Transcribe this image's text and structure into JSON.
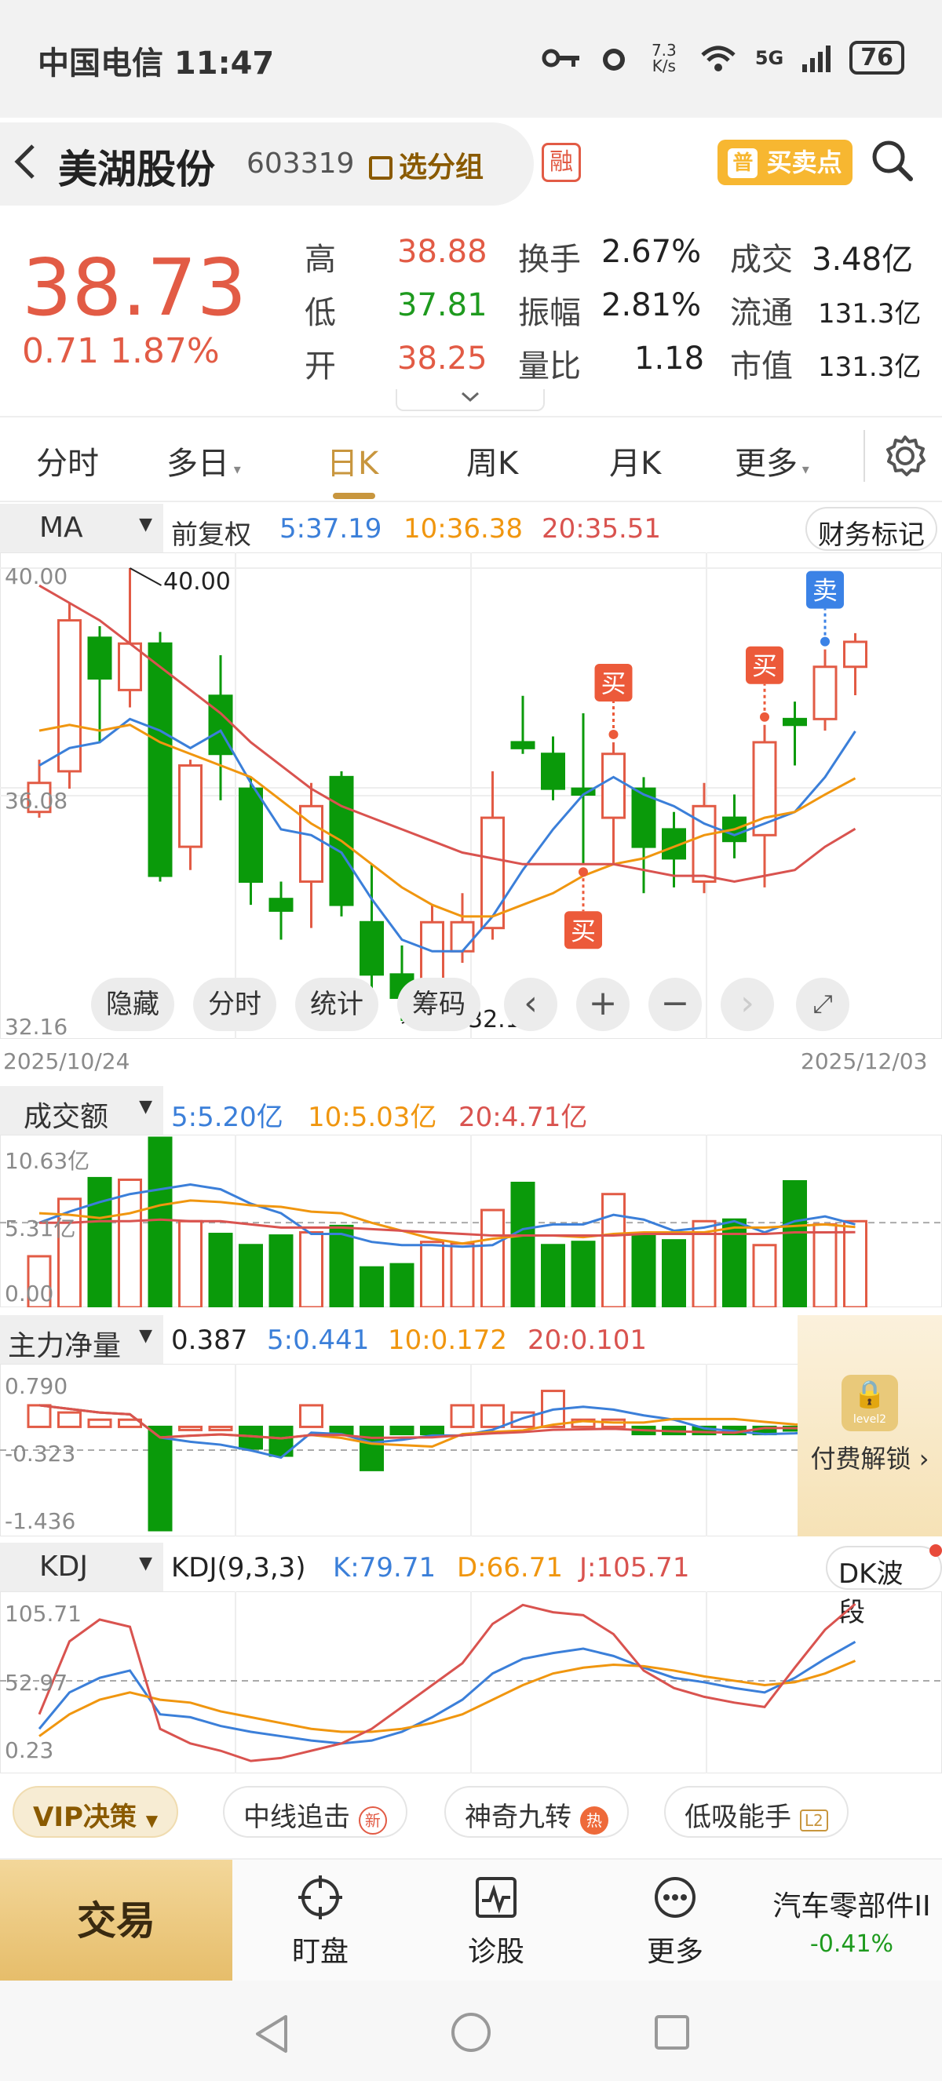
{
  "status": {
    "carrier": "中国电信 11:47",
    "net_speed": "7.3 K/s",
    "net_type": "5G",
    "battery": "76"
  },
  "header": {
    "back_icon": "chevron-left-icon",
    "stock_name": "美湖股份",
    "stock_code": "603319",
    "group_label": "选分组",
    "margin_badge": "融",
    "buy_sell_label": "买卖点",
    "buy_sell_prefix": "普"
  },
  "quote": {
    "price": "38.73",
    "change": "0.71  1.87%",
    "high_label": "高",
    "high": "38.88",
    "low_label": "低",
    "low": "37.81",
    "open_label": "开",
    "open": "38.25",
    "turnover_label": "换手",
    "turnover": "2.67%",
    "amplitude_label": "振幅",
    "amplitude": "2.81%",
    "vol_ratio_label": "量比",
    "vol_ratio": "1.18",
    "deal_label": "成交",
    "deal": "3.48亿",
    "float_label": "流通",
    "float": "131.3亿",
    "mcap_label": "市值",
    "mcap": "131.3亿"
  },
  "tabs": [
    "分时",
    "多日",
    "日K",
    "周K",
    "月K",
    "更多"
  ],
  "active_tab": 2,
  "ma_bar": {
    "label": "MA",
    "adjust": "前复权",
    "ma5": "5:37.19",
    "ma10": "10:36.38",
    "ma20": "20:35.51",
    "fin_btn": "财务标记"
  },
  "kchart": {
    "ylabels": {
      "top": "40.00",
      "mid": "36.08",
      "bottom": "32.16"
    },
    "hi_mark": "40.00",
    "lo_mark": "32.16",
    "date_start": "2025/10/24",
    "date_end": "2025/12/03",
    "buy": "买",
    "sell": "卖"
  },
  "controls": {
    "hide": "隐藏",
    "time": "分时",
    "stats": "统计",
    "chips": "筹码"
  },
  "vol_bar": {
    "label": "成交额",
    "ma5": "5:5.20亿",
    "ma10": "10:5.03亿",
    "ma20": "20:4.71亿"
  },
  "vol_axis": {
    "top": "10.63亿",
    "mid": "5.31亿",
    "bottom": "0.00"
  },
  "flow_bar": {
    "label": "主力净量",
    "value": "0.387",
    "ma5": "5:0.441",
    "ma10": "10:0.172",
    "ma20": "20:0.101"
  },
  "flow_axis": {
    "top": "0.790",
    "mid": "-0.323",
    "bottom": "-1.436"
  },
  "unlock": {
    "label": "付费解锁",
    "badge": "level2"
  },
  "kdj_bar": {
    "label": "KDJ",
    "param": "KDJ(9,3,3)",
    "k": "K:79.71",
    "d": "D:66.71",
    "j": "J:105.71",
    "dk_btn": "DK波段"
  },
  "kdj_axis": {
    "top": "105.71",
    "mid": "52.97",
    "bottom": "0.23"
  },
  "strategies": {
    "vip": "VIP决策",
    "s1": "中线追击",
    "s1_tag": "新",
    "s2": "神奇九转",
    "s2_tag": "热",
    "s3": "低吸能手",
    "s3_tag": "L2"
  },
  "nav": {
    "trade": "交易",
    "watch": "盯盘",
    "diagnose": "诊股",
    "more": "更多",
    "sector": "汽车零部件II",
    "sector_chg": "-0.41%"
  },
  "colors": {
    "up": "#e25b45",
    "down": "#0a9a0a",
    "ma5": "#3b7fd9",
    "ma10": "#f0960f",
    "ma20": "#d9534f",
    "accent": "#c8963e"
  },
  "chart_data": {
    "type": "candlestick",
    "ylim": [
      32.16,
      40.0
    ],
    "candles": [
      {
        "o": 35.8,
        "c": 36.3,
        "h": 36.7,
        "l": 35.7
      },
      {
        "o": 36.5,
        "c": 39.1,
        "h": 39.4,
        "l": 36.2
      },
      {
        "o": 38.8,
        "c": 38.1,
        "h": 39.0,
        "l": 37.0
      },
      {
        "o": 37.9,
        "c": 38.7,
        "h": 40.0,
        "l": 37.6
      },
      {
        "o": 38.7,
        "c": 34.7,
        "h": 38.9,
        "l": 34.6
      },
      {
        "o": 35.2,
        "c": 36.6,
        "h": 36.7,
        "l": 34.8
      },
      {
        "o": 37.8,
        "c": 36.8,
        "h": 38.5,
        "l": 36.0
      },
      {
        "o": 36.2,
        "c": 34.6,
        "h": 36.4,
        "l": 34.2
      },
      {
        "o": 34.3,
        "c": 34.1,
        "h": 34.6,
        "l": 33.6
      },
      {
        "o": 34.6,
        "c": 35.9,
        "h": 36.3,
        "l": 33.8
      },
      {
        "o": 36.4,
        "c": 34.2,
        "h": 36.5,
        "l": 34.0
      },
      {
        "o": 33.9,
        "c": 33.0,
        "h": 34.9,
        "l": 32.7
      },
      {
        "o": 33.0,
        "c": 32.6,
        "h": 33.5,
        "l": 32.2
      },
      {
        "o": 32.8,
        "c": 33.9,
        "h": 34.2,
        "l": 32.5
      },
      {
        "o": 33.4,
        "c": 33.9,
        "h": 34.4,
        "l": 33.2
      },
      {
        "o": 33.8,
        "c": 35.7,
        "h": 36.5,
        "l": 33.6
      },
      {
        "o": 37.0,
        "c": 36.9,
        "h": 37.8,
        "l": 36.8
      },
      {
        "o": 36.8,
        "c": 36.2,
        "h": 37.1,
        "l": 36.0
      },
      {
        "o": 36.2,
        "c": 36.1,
        "h": 37.5,
        "l": 34.9
      },
      {
        "o": 35.7,
        "c": 36.8,
        "h": 37.0,
        "l": 34.9
      },
      {
        "o": 36.2,
        "c": 35.2,
        "h": 36.4,
        "l": 34.4
      },
      {
        "o": 35.5,
        "c": 35.0,
        "h": 35.8,
        "l": 34.5
      },
      {
        "o": 34.6,
        "c": 35.9,
        "h": 36.3,
        "l": 34.4
      },
      {
        "o": 35.7,
        "c": 35.3,
        "h": 36.1,
        "l": 35.0
      },
      {
        "o": 35.4,
        "c": 37.0,
        "h": 37.3,
        "l": 34.5
      },
      {
        "o": 37.4,
        "c": 37.3,
        "h": 37.7,
        "l": 36.6
      },
      {
        "o": 37.4,
        "c": 38.3,
        "h": 38.6,
        "l": 37.2
      },
      {
        "o": 38.3,
        "c": 38.73,
        "h": 38.88,
        "l": 37.81
      }
    ],
    "ma5": [
      36.6,
      36.9,
      37.0,
      37.4,
      37.2,
      36.9,
      37.2,
      36.3,
      35.5,
      35.4,
      35.1,
      34.3,
      33.6,
      33.4,
      33.4,
      34.0,
      34.8,
      35.5,
      36.1,
      36.4,
      36.1,
      35.9,
      35.6,
      35.4,
      35.6,
      35.8,
      36.4,
      37.19
    ],
    "ma10": [
      37.2,
      37.3,
      37.2,
      37.3,
      37.0,
      36.8,
      36.6,
      36.4,
      36.0,
      35.6,
      35.3,
      34.9,
      34.5,
      34.2,
      34.0,
      34.0,
      34.2,
      34.4,
      34.7,
      34.9,
      35.0,
      35.2,
      35.4,
      35.5,
      35.7,
      35.8,
      36.1,
      36.38
    ],
    "ma20": [
      39.7,
      39.4,
      39.1,
      38.7,
      38.3,
      37.9,
      37.5,
      37.0,
      36.6,
      36.2,
      35.9,
      35.7,
      35.5,
      35.3,
      35.1,
      35.0,
      34.9,
      34.9,
      34.9,
      34.9,
      34.8,
      34.7,
      34.7,
      34.6,
      34.7,
      34.8,
      35.2,
      35.51
    ],
    "signals": [
      {
        "index": 18,
        "type": "buy",
        "side": "below"
      },
      {
        "index": 19,
        "type": "buy",
        "side": "above"
      },
      {
        "index": 24,
        "type": "buy",
        "side": "above"
      },
      {
        "index": 26,
        "type": "sell",
        "side": "above"
      }
    ],
    "volume": [
      3.2,
      6.8,
      8.1,
      8.0,
      10.63,
      5.4,
      4.6,
      3.9,
      4.5,
      4.7,
      5.1,
      2.5,
      2.7,
      4.1,
      4.0,
      6.1,
      7.8,
      3.9,
      4.1,
      7.1,
      4.6,
      4.2,
      5.4,
      5.5,
      3.9,
      7.9,
      5.2,
      5.4
    ],
    "vol_ma5": [
      5.3,
      6.0,
      6.6,
      7.1,
      7.4,
      7.7,
      7.4,
      6.5,
      5.9,
      4.6,
      4.6,
      4.1,
      3.9,
      3.9,
      3.8,
      3.9,
      4.9,
      5.2,
      5.2,
      5.8,
      5.5,
      4.8,
      5.0,
      5.4,
      4.7,
      5.4,
      5.7,
      5.2
    ],
    "vol_ma10": [
      5.9,
      5.8,
      5.6,
      5.9,
      6.4,
      6.7,
      6.6,
      6.4,
      6.3,
      6.0,
      5.9,
      5.3,
      4.8,
      4.3,
      4.0,
      4.3,
      4.5,
      4.5,
      4.4,
      4.6,
      4.7,
      4.7,
      4.7,
      5.0,
      5.0,
      5.1,
      5.2,
      5.03
    ],
    "vol_ma20": [
      5.3,
      5.3,
      5.4,
      5.4,
      5.5,
      5.4,
      5.4,
      5.2,
      5.0,
      5.0,
      5.0,
      4.9,
      4.8,
      4.7,
      4.6,
      4.5,
      4.5,
      4.5,
      4.5,
      4.5,
      4.6,
      4.6,
      4.6,
      4.6,
      4.6,
      4.7,
      4.7,
      4.71
    ],
    "flow": [
      0.3,
      0.2,
      0.1,
      0.1,
      -1.436,
      0.0,
      0.0,
      -0.3,
      -0.4,
      0.3,
      -0.1,
      -0.6,
      -0.1,
      -0.1,
      0.3,
      0.3,
      0.2,
      0.5,
      0.1,
      0.1,
      -0.1,
      -0.1,
      -0.1,
      -0.1,
      -0.1,
      -0.05,
      0.0,
      0.387
    ],
    "flow_up_days": [
      0,
      1,
      2,
      3,
      5,
      6,
      9,
      14,
      15,
      16,
      17,
      18,
      19,
      27
    ],
    "kdj_k": [
      20,
      45,
      55,
      60,
      30,
      28,
      22,
      18,
      15,
      12,
      10,
      12,
      18,
      28,
      40,
      58,
      68,
      72,
      75,
      70,
      62,
      55,
      52,
      48,
      45,
      55,
      68,
      79.71
    ],
    "kdj_d": [
      15,
      30,
      40,
      45,
      40,
      38,
      32,
      28,
      24,
      20,
      18,
      18,
      20,
      24,
      30,
      40,
      50,
      58,
      62,
      64,
      63,
      60,
      56,
      53,
      50,
      52,
      58,
      66.71
    ],
    "kdj_j": [
      30,
      80,
      95,
      90,
      20,
      10,
      5,
      -2,
      0,
      5,
      10,
      20,
      35,
      50,
      65,
      92,
      105,
      100,
      98,
      85,
      60,
      48,
      42,
      38,
      35,
      62,
      88,
      105.71
    ]
  }
}
